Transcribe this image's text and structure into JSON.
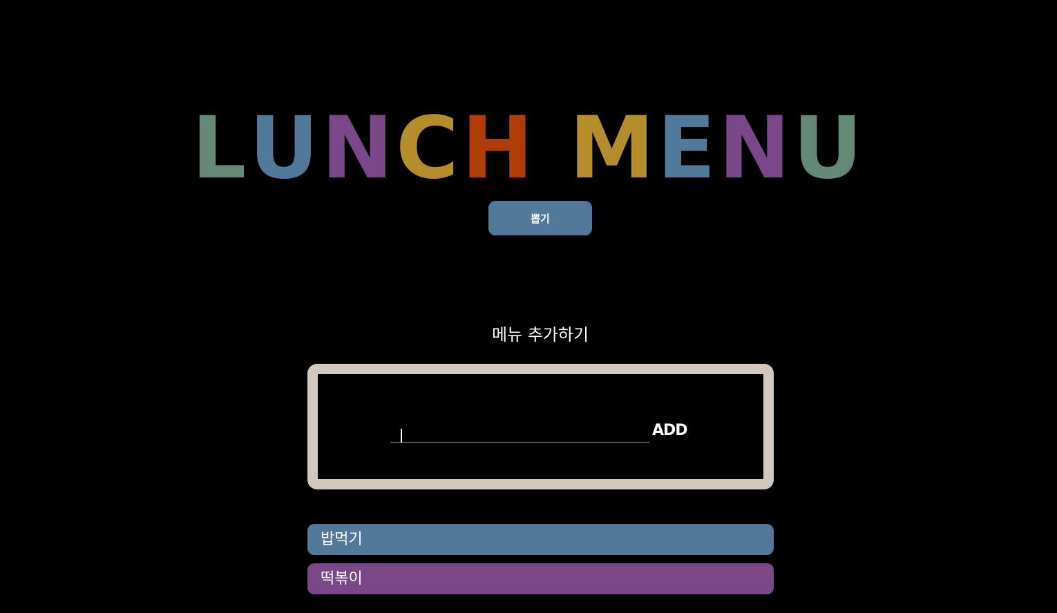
{
  "title": {
    "letters": [
      "L",
      "U",
      "N",
      "C",
      "H",
      " ",
      "M",
      "E",
      "N",
      "U"
    ],
    "letter_colors": [
      "#658775",
      "#52789a",
      "#7a4889",
      "#b58e2b",
      "#b03c07",
      "#000000",
      "#b58e2b",
      "#52789a",
      "#7a4889",
      "#658775"
    ]
  },
  "pick_button": {
    "label": "뽑기",
    "color": "#52789a"
  },
  "add_section": {
    "title": "메뉴 추가하기",
    "input_value": "",
    "input_placeholder": "",
    "add_label": "ADD",
    "frame_color": "#d2c8bd"
  },
  "menu_items": [
    {
      "label": "밥먹기",
      "color": "#52789a"
    },
    {
      "label": "떡볶이",
      "color": "#7a4889"
    }
  ]
}
